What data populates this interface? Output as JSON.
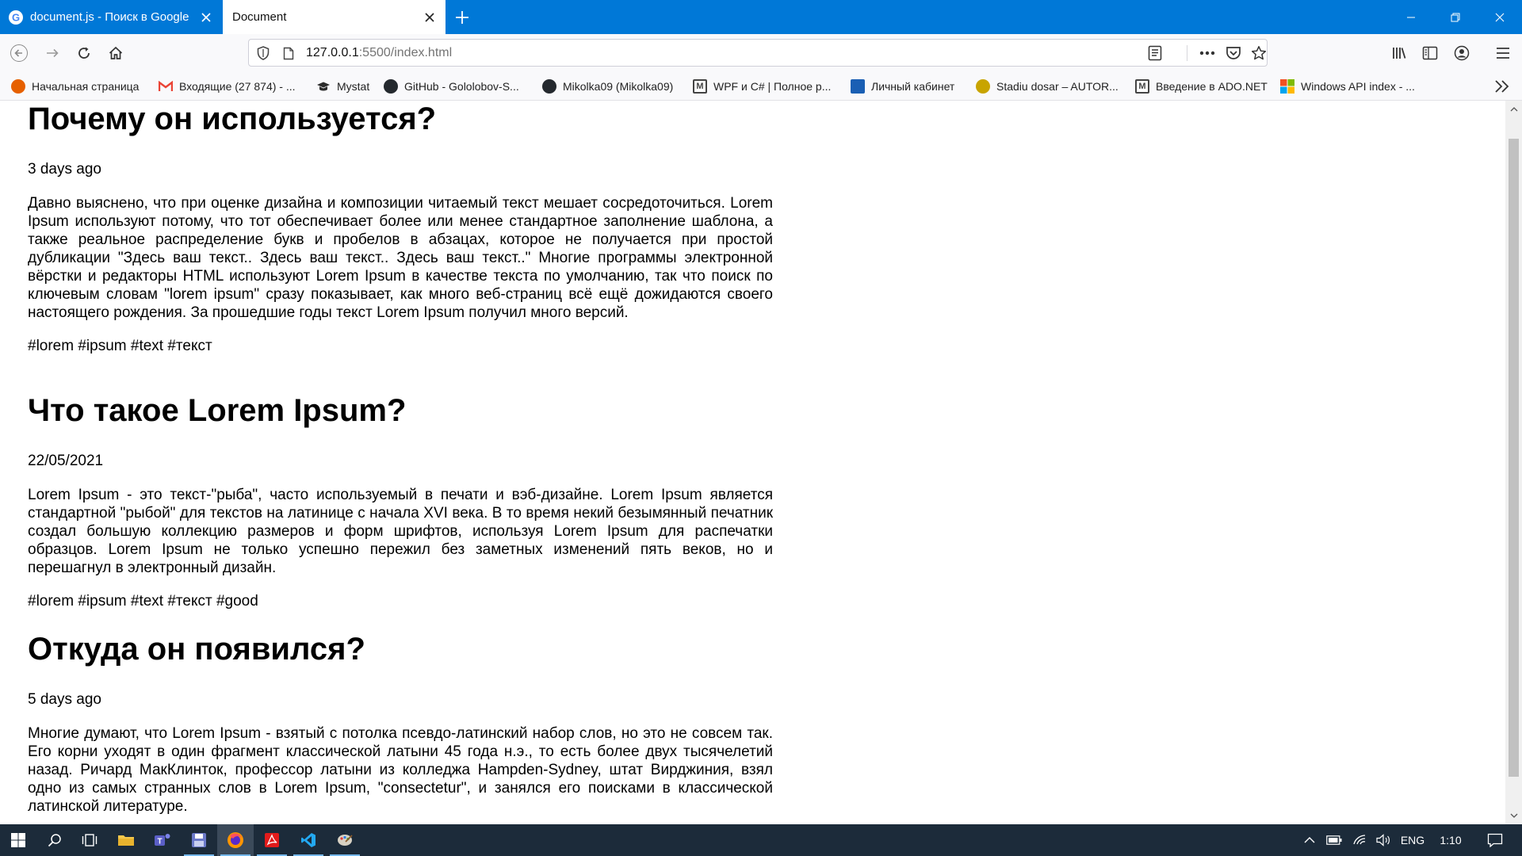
{
  "browser": {
    "tabs": [
      {
        "title": "document.js - Поиск в Google",
        "active": false,
        "favicon": "google-icon"
      },
      {
        "title": "Document",
        "active": true,
        "favicon": "none"
      }
    ],
    "url": {
      "host": "127.0.0.1",
      "rest": ":5500/index.html"
    }
  },
  "bookmarks": [
    {
      "label": "Начальная страница",
      "icon": "firefox-icon",
      "color": "#e66000"
    },
    {
      "label": "Входящие (27 874) - ...",
      "icon": "gmail-icon",
      "color": "#ea4335"
    },
    {
      "label": "Mystat",
      "icon": "graduation-cap-icon",
      "color": "#2b2b2b"
    },
    {
      "label": "GitHub - Gololobov-S...",
      "icon": "github-icon",
      "color": "#24292e"
    },
    {
      "label": "Mikolka09 (Mikolka09)",
      "icon": "github-icon",
      "color": "#24292e"
    },
    {
      "label": "WPF и C# | Полное р...",
      "icon": "metanit-icon",
      "color": "#444444"
    },
    {
      "label": "Личный кабинет",
      "icon": "cabinet-icon",
      "color": "#1a5fb4"
    },
    {
      "label": "Stadiu dosar – AUTOR...",
      "icon": "seal-icon",
      "color": "#c8a400"
    },
    {
      "label": "Введение в ADO.NET",
      "icon": "metanit-icon",
      "color": "#444444"
    },
    {
      "label": "Windows API index - ...",
      "icon": "windows-icon",
      "color": "#f25022"
    }
  ],
  "articles": [
    {
      "title": "Почему он используется?",
      "date": "3 days ago",
      "text": "Давно выяснено, что при оценке дизайна и композиции читаемый текст мешает сосредоточиться. Lorem Ipsum используют потому, что тот обеспечивает более или менее стандартное заполнение шаблона, а также реальное распределение букв и пробелов в абзацах, которое не получается при простой дубликации \"Здесь ваш текст.. Здесь ваш текст.. Здесь ваш текст..\" Многие программы электронной вёрстки и редакторы HTML используют Lorem Ipsum в качестве текста по умолчанию, так что поиск по ключевым словам \"lorem ipsum\" сразу показывает, как много веб-страниц всё ещё дожидаются своего настоящего рождения. За прошедшие годы текст Lorem Ipsum получил много версий.",
      "tags": "#lorem #ipsum #text #текст"
    },
    {
      "title": "Что такое Lorem Ipsum?",
      "date": "22/05/2021",
      "text": "Lorem Ipsum - это текст-\"рыба\", часто используемый в печати и вэб-дизайне. Lorem Ipsum является стандартной \"рыбой\" для текстов на латинице с начала XVI века. В то время некий безымянный печатник создал большую коллекцию размеров и форм шрифтов, используя Lorem Ipsum для распечатки образцов. Lorem Ipsum не только успешно пережил без заметных изменений пять веков, но и перешагнул в электронный дизайн.",
      "tags": "#lorem #ipsum #text #текст #good"
    },
    {
      "title": "Откуда он появился?",
      "date": "5 days ago",
      "text": "Многие думают, что Lorem Ipsum - взятый с потолка псевдо-латинский набор слов, но это не совсем так. Его корни уходят в один фрагмент классической латыни 45 года н.э., то есть более двух тысячелетий назад. Ричард МакКлинток, профессор латыни из колледжа Hampden-Sydney, штат Вирджиния, взял одно из самых странных слов в Lorem Ipsum, \"consectetur\", и занялся его поисками в классической латинской литературе.",
      "tags": ""
    }
  ],
  "taskbar": {
    "tray": {
      "language": "ENG",
      "time": "1:10"
    }
  },
  "colors": {
    "tabbar": "#0078d7",
    "taskbar": "#1c2b3a"
  }
}
